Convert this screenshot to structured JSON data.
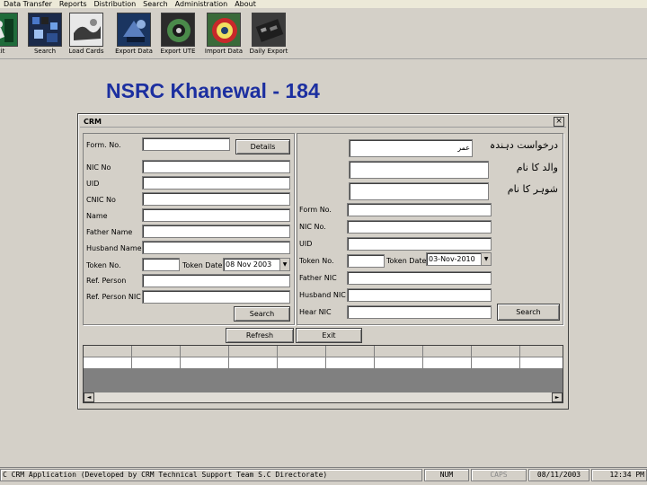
{
  "menubar": {
    "items": [
      "Data Transfer",
      "Reports",
      "Distribution",
      "Search",
      "Administration",
      "About"
    ]
  },
  "toolbar": {
    "buttons": [
      {
        "label": "xit",
        "icon": "exit-door-icon"
      },
      {
        "label": "Search",
        "icon": "search-icon"
      },
      {
        "label": "Load Cards",
        "icon": "load-cards-icon"
      },
      {
        "label": "Export Data",
        "icon": "export-data-icon"
      },
      {
        "label": "Export UTE",
        "icon": "export-ute-icon"
      },
      {
        "label": "Import Data",
        "icon": "import-data-icon"
      },
      {
        "label": "Daily Export",
        "icon": "daily-export-icon"
      }
    ]
  },
  "page": {
    "title": "NSRC Khanewal - 184"
  },
  "dialog": {
    "title": "CRM",
    "close": "×",
    "left": {
      "form_no_label": "Form. No.",
      "details_button": "Details",
      "nic_no_label": "NIC No",
      "uid_label": "UID",
      "cnic_no_label": "CNIC No",
      "name_label": "Name",
      "father_name_label": "Father Name",
      "husband_name_label": "Husband Name",
      "token_no_label": "Token No.",
      "token_date_label": "Token Date",
      "token_date_value": "08 Nov 2003",
      "ref_person_label": "Ref. Person",
      "ref_person_nic_label": "Ref. Person NIC",
      "search_button": "Search"
    },
    "right": {
      "urdu_applicant_label": "درخواست دہندہ",
      "urdu_applicant_value": "عمر",
      "urdu_father_label": "والد کا نام",
      "urdu_husband_label": "شوہر کا نام",
      "form_no_label": "Form No.",
      "nic_no_label": "NIC No.",
      "uid_label": "UID",
      "token_no_label": "Token No.",
      "token_date_label": "Token Date",
      "token_date_value": "03-Nov-2010",
      "father_nic_label": "Father NIC",
      "husband_nic_label": "Husband NIC",
      "hear_nic_label": "Hear NIC",
      "search_button": "Search"
    },
    "refresh_button": "Refresh",
    "exit_button": "Exit",
    "scroll_left": "◄",
    "scroll_right": "►",
    "dropdown_arrow": "▼"
  },
  "statusbar": {
    "app_text": "C CRM Application (Developed by CRM Technical Support Team S.C Directorate)",
    "num": "NUM",
    "caps": "CAPS",
    "date": "08/11/2003",
    "time": "12:34 PM"
  }
}
